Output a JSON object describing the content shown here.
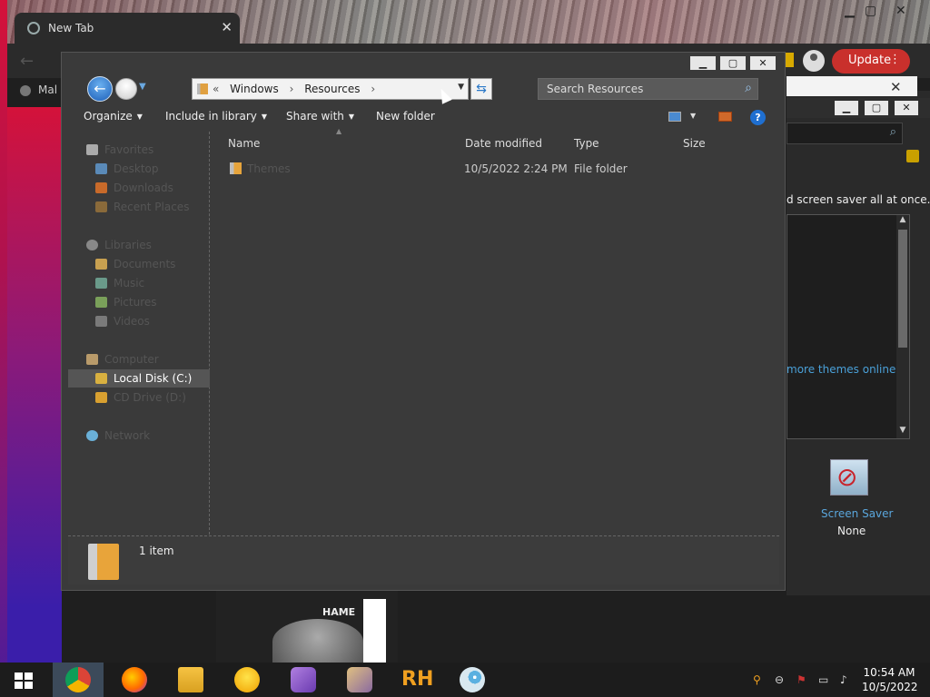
{
  "chrome": {
    "tab_title": "New Tab",
    "update_label": "Update",
    "bookmark_label": "Mal",
    "bottom_text": "HAME"
  },
  "personalization": {
    "description": "d screen saver all at once.",
    "more_themes": "more themes online",
    "screensaver_label": "Screen Saver",
    "screensaver_value": "None"
  },
  "explorer": {
    "breadcrumbs": [
      "Windows",
      "Resources"
    ],
    "breadcrumb_prefix": "«",
    "search_placeholder": "Search Resources",
    "commands": {
      "organize": "Organize",
      "include": "Include in library",
      "share": "Share with",
      "new_folder": "New folder"
    },
    "nav": {
      "favorites": "Favorites",
      "desktop": "Desktop",
      "downloads": "Downloads",
      "recent": "Recent Places",
      "libraries": "Libraries",
      "documents": "Documents",
      "music": "Music",
      "pictures": "Pictures",
      "videos": "Videos",
      "computer": "Computer",
      "local_disk": "Local Disk (C:)",
      "cd_drive": "CD Drive (D:)",
      "network": "Network"
    },
    "columns": {
      "name": "Name",
      "date": "Date modified",
      "type": "Type",
      "size": "Size"
    },
    "files": [
      {
        "name": "Themes",
        "date": "10/5/2022 2:24 PM",
        "type": "File folder",
        "size": ""
      }
    ],
    "status": "1 item"
  },
  "taskbar": {
    "time": "10:54 AM",
    "date": "10/5/2022",
    "rh_label": "RH"
  },
  "colors": {
    "update_red": "#c9302c",
    "link_blue": "#4aa0d8",
    "accent_blue": "#1f6fd0"
  }
}
